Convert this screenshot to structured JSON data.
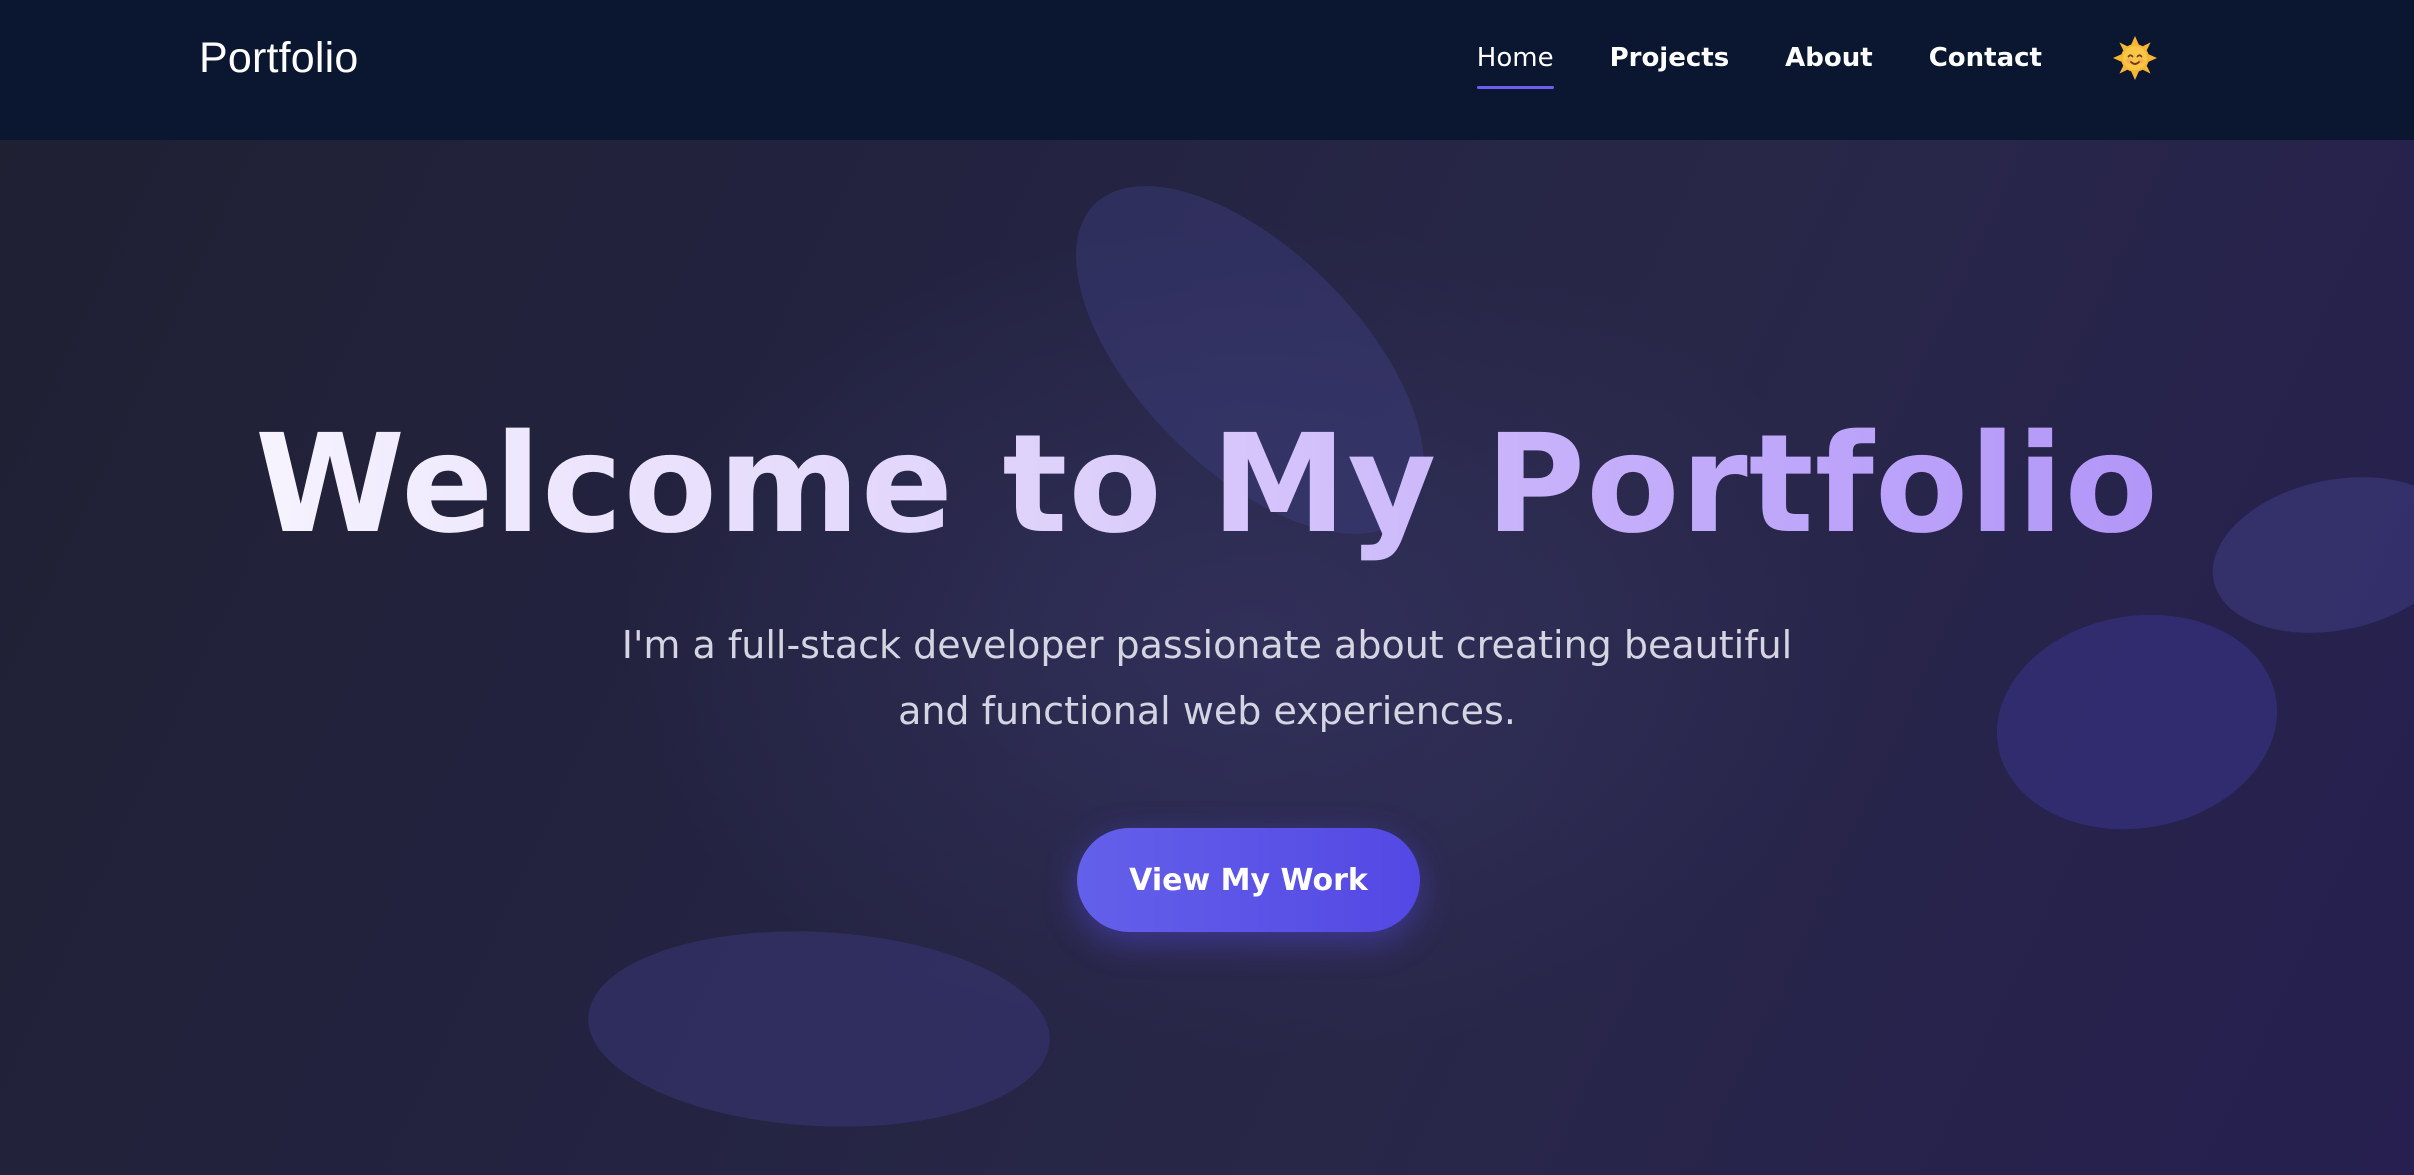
{
  "header": {
    "brand": "Portfolio",
    "nav": [
      {
        "label": "Home",
        "active": true
      },
      {
        "label": "Projects",
        "active": false
      },
      {
        "label": "About",
        "active": false
      },
      {
        "label": "Contact",
        "active": false
      }
    ],
    "theme_toggle_icon": "sun-smile-icon"
  },
  "hero": {
    "title": "Welcome to My Portfolio",
    "subtitle": "I'm a full-stack developer passionate about creating beautiful and functional web experiences.",
    "cta_label": "View My Work"
  },
  "colors": {
    "nav_background": "#0b1730",
    "accent": "#6d5ef2",
    "button_start": "#6360ea",
    "button_end": "#5448e4",
    "title_gradient_end": "#a98bf7",
    "sun": "#f5b731"
  }
}
